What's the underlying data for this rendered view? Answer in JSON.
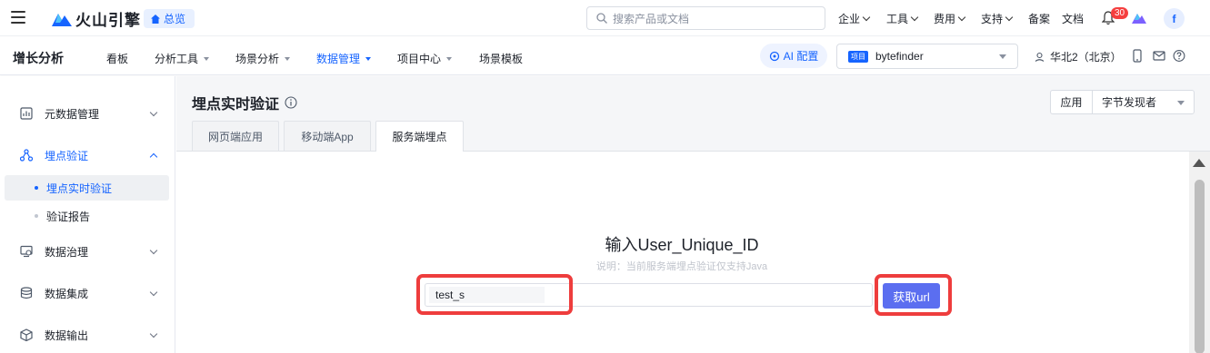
{
  "topbar": {
    "logo_text": "火山引擎",
    "overview_label": "总览",
    "search_placeholder": "搜索产品或文档",
    "nav": [
      "企业",
      "工具",
      "费用",
      "支持",
      "备案",
      "文档"
    ],
    "notification_count": "30",
    "avatar_letter": "f"
  },
  "subbar": {
    "app_title": "增长分析",
    "nav": [
      "看板",
      "分析工具",
      "场景分析",
      "数据管理",
      "项目中心",
      "场景模板"
    ],
    "active_nav": "数据管理",
    "ai_label": "AI 配置",
    "project_tag": "项目",
    "project_name": "bytefinder",
    "region": "华北2（北京）"
  },
  "sidebar": {
    "groups": [
      {
        "label": "元数据管理",
        "icon": "metadata-icon"
      },
      {
        "label": "埋点验证",
        "icon": "tracking-icon",
        "expanded": true
      },
      {
        "label": "数据治理",
        "icon": "governance-icon"
      },
      {
        "label": "数据集成",
        "icon": "database-icon"
      },
      {
        "label": "数据输出",
        "icon": "cube-icon"
      }
    ],
    "sub_items": [
      {
        "label": "埋点实时验证",
        "selected": true
      },
      {
        "label": "验证报告",
        "selected": false
      }
    ]
  },
  "main": {
    "title": "埋点实时验证",
    "app_select_label": "应用",
    "app_select_value": "字节发现者",
    "tabs": [
      "网页端应用",
      "移动端App",
      "服务端埋点"
    ],
    "active_tab": "服务端埋点",
    "panel_title": "输入User_Unique_ID",
    "panel_desc": "说明：当前服务端埋点验证仅支持Java",
    "uid_value": "test_s",
    "get_url_label": "获取url"
  },
  "colors": {
    "accent": "#1664ff",
    "button": "#5b6ef0",
    "highlight": "#ee3d3d",
    "badge": "#f53f3f"
  }
}
